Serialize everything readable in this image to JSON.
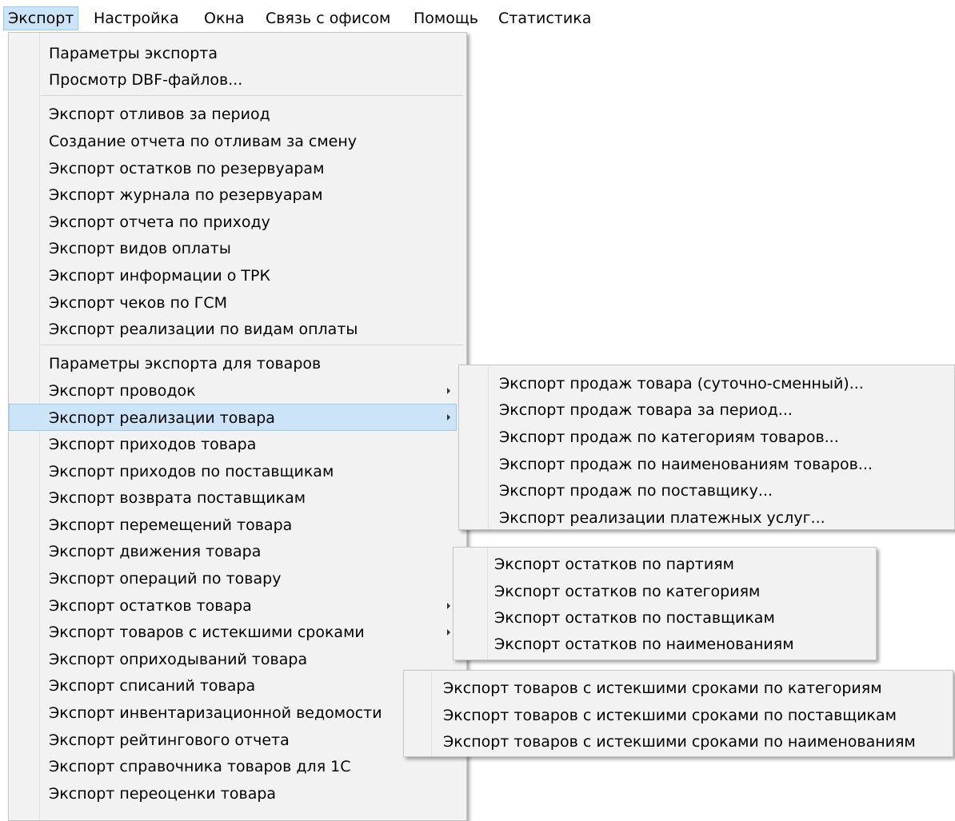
{
  "menubar": {
    "items": [
      "Экспорт",
      "Настройка",
      "Окна",
      "Связь с офисом",
      "Помощь",
      "Статистика"
    ]
  },
  "main_menu": {
    "group1": [
      "Параметры экспорта",
      "Просмотр DBF-файлов..."
    ],
    "group2": [
      "Экспорт отливов за период",
      "Создание отчета по отливам за смену",
      "Экспорт остатков по резервуарам",
      "Экспорт журнала по резервуарам",
      "Экспорт отчета по приходу",
      "Экспорт видов оплаты",
      "Экспорт информации о ТРК",
      "Экспорт чеков по ГСМ",
      "Экспорт реализации по видам оплаты"
    ],
    "group3": [
      "Параметры экспорта для товаров",
      "Экспорт проводок",
      "Экспорт реализации товара",
      "Экспорт приходов товара",
      "Экспорт приходов по поставщикам",
      "Экспорт возврата поставщикам",
      "Экспорт перемещений товара",
      "Экспорт движения товара",
      "Экспорт операций по товару",
      "Экспорт остатков товара",
      "Экспорт товаров с истекшими сроками",
      "Экспорт оприходываний товара",
      "Экспорт списаний товара",
      "Экспорт инвентаризационной ведомости",
      "Экспорт рейтингового отчета",
      "Экспорт справочника товаров для 1С",
      "Экспорт переоценки товара"
    ]
  },
  "sales_submenu": [
    "Экспорт продаж товара (суточно-сменный)...",
    "Экспорт продаж товара за период...",
    "Экспорт продаж по категориям товаров...",
    "Экспорт продаж по наименованиям товаров...",
    "Экспорт продаж по поставщику...",
    "Экспорт реализации платежных услуг..."
  ],
  "stock_submenu": [
    "Экспорт остатков по партиям",
    "Экспорт остатков по категориям",
    "Экспорт остатков по поставщикам",
    "Экспорт остатков по наименованиям"
  ],
  "expired_submenu": [
    "Экспорт товаров с истекшими сроками по категориям",
    "Экспорт товаров с истекшими сроками по поставщикам",
    "Экспорт товаров с истекшими сроками по наименованиям"
  ],
  "colors": {
    "highlight": "#cce4f7",
    "highlight_border": "#99c9ef",
    "menu_bg": "#f2f2f2"
  }
}
